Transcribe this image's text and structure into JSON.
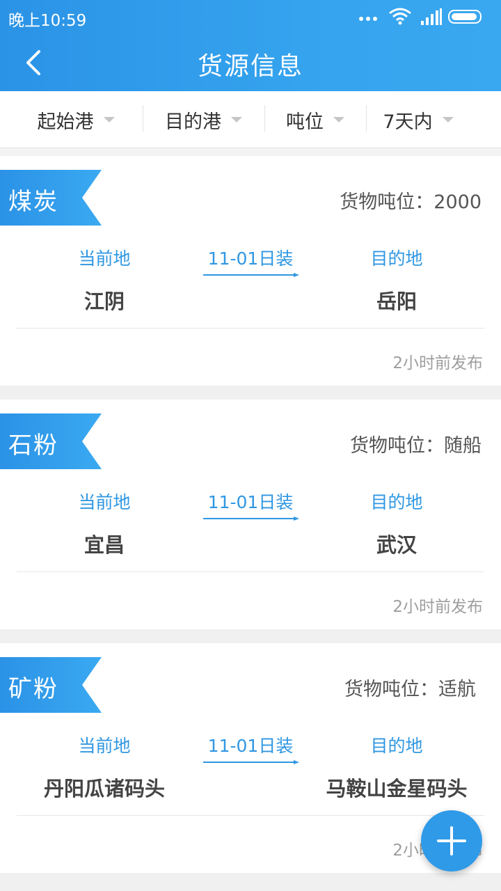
{
  "status_bar": {
    "time": "晚上10:59"
  },
  "header": {
    "title": "货源信息"
  },
  "filters": [
    {
      "label": "起始港"
    },
    {
      "label": "目的港"
    },
    {
      "label": "吨位"
    },
    {
      "label": "7天内"
    }
  ],
  "cards": [
    {
      "category": "煤炭",
      "tonnage": "货物吨位：2000",
      "origin_label": "当前地",
      "date_label": "11-01日装",
      "dest_label": "目的地",
      "origin": "江阴",
      "destination": "岳阳",
      "posted": "2小时前发布"
    },
    {
      "category": "石粉",
      "tonnage": "货物吨位：随船",
      "origin_label": "当前地",
      "date_label": "11-01日装",
      "dest_label": "目的地",
      "origin": "宜昌",
      "destination": "武汉",
      "posted": "2小时前发布"
    },
    {
      "category": "矿粉",
      "tonnage": "货物吨位：适航",
      "origin_label": "当前地",
      "date_label": "11-01日装",
      "dest_label": "目的地",
      "origin": "丹阳瓜诸码头",
      "destination": "马鞍山金星码头",
      "posted": "2小时前发布"
    }
  ],
  "icons": {
    "back": "chevron-left-icon",
    "fab": "plus-icon",
    "wifi": "wifi-icon",
    "signal": "signal-icon",
    "battery": "battery-icon"
  },
  "colors": {
    "primary": "#2f97e2",
    "ribbon": "#2b95e8"
  }
}
